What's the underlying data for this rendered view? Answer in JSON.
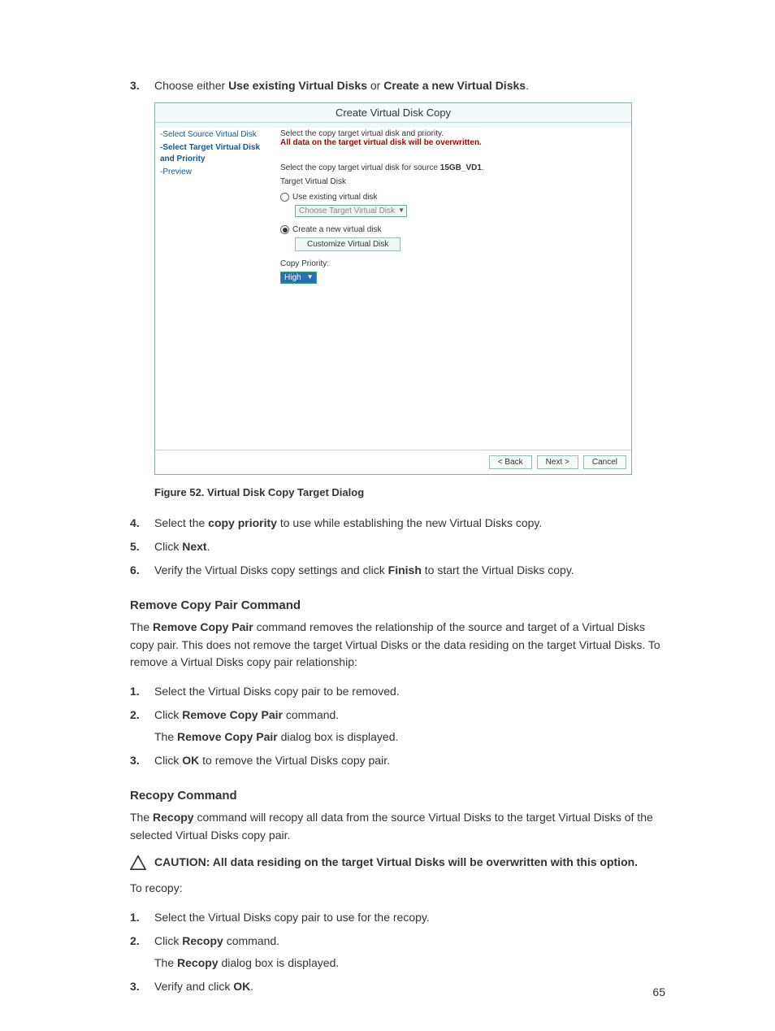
{
  "step3": {
    "num": "3.",
    "text_a": "Choose either ",
    "bold_a": "Use existing Virtual Disks",
    "text_b": " or ",
    "bold_b": "Create a new Virtual Disks",
    "text_c": "."
  },
  "dialog": {
    "title": "Create Virtual Disk Copy",
    "side": {
      "item1": "-Select Source Virtual Disk",
      "item2": "-Select Target Virtual Disk and Priority",
      "item3": "-Preview"
    },
    "main": {
      "line1": "Select the copy target virtual disk and priority.",
      "line2": "All data on the target virtual disk will be overwritten.",
      "line3a": "Select the copy target virtual disk for source ",
      "line3b": "15GB_VD1",
      "line3c": ".",
      "line4": "Target Virtual Disk",
      "radio1": "Use existing virtual disk",
      "select1": "Choose Target Virtual Disk",
      "radio2": "Create a new virtual disk",
      "btn1": "Customize Virtual Disk",
      "line5": "Copy Priority:",
      "select2": "High"
    },
    "foot": {
      "back": "< Back",
      "next": "Next >",
      "cancel": "Cancel"
    }
  },
  "fig_caption": "Figure 52. Virtual Disk Copy Target Dialog",
  "step4": {
    "num": "4.",
    "text_a": "Select the ",
    "bold_a": "copy priority",
    "text_b": " to use while establishing the new Virtual Disks copy."
  },
  "step5": {
    "num": "5.",
    "text_a": "Click ",
    "bold_a": "Next",
    "text_b": "."
  },
  "step6": {
    "num": "6.",
    "text_a": "Verify the Virtual Disks copy settings and click ",
    "bold_a": "Finish",
    "text_b": " to start the Virtual Disks copy."
  },
  "remove": {
    "heading": "Remove Copy Pair Command",
    "para_a": "The ",
    "para_b": "Remove Copy Pair",
    "para_c": " command removes the relationship of the source and target of a Virtual Disks copy pair. This does not remove the target Virtual Disks or the data residing on the target Virtual Disks. To remove a Virtual Disks copy pair relationship:",
    "s1": {
      "num": "1.",
      "text": "Select the Virtual Disks copy pair to be removed."
    },
    "s2": {
      "num": "2.",
      "text_a": "Click ",
      "bold_a": "Remove Copy Pair",
      "text_b": " command.",
      "sub_a": "The ",
      "sub_b": "Remove Copy Pair",
      "sub_c": " dialog box is displayed."
    },
    "s3": {
      "num": "3.",
      "text_a": "Click ",
      "bold_a": "OK",
      "text_b": " to remove the Virtual Disks copy pair."
    }
  },
  "recopy": {
    "heading": "Recopy Command",
    "para_a": "The ",
    "para_b": "Recopy",
    "para_c": " command will recopy all data from the source Virtual Disks to the target Virtual Disks of the selected Virtual Disks copy pair.",
    "caution": "CAUTION: All data residing on the target Virtual Disks will be overwritten with this option.",
    "lead": "To recopy:",
    "s1": {
      "num": "1.",
      "text": "Select the Virtual Disks copy pair to use for the recopy."
    },
    "s2": {
      "num": "2.",
      "text_a": "Click ",
      "bold_a": "Recopy",
      "text_b": " command.",
      "sub_a": "The ",
      "sub_b": "Recopy",
      "sub_c": " dialog box is displayed."
    },
    "s3": {
      "num": "3.",
      "text_a": "Verify and click ",
      "bold_a": "OK",
      "text_b": "."
    }
  },
  "page_number": "65"
}
